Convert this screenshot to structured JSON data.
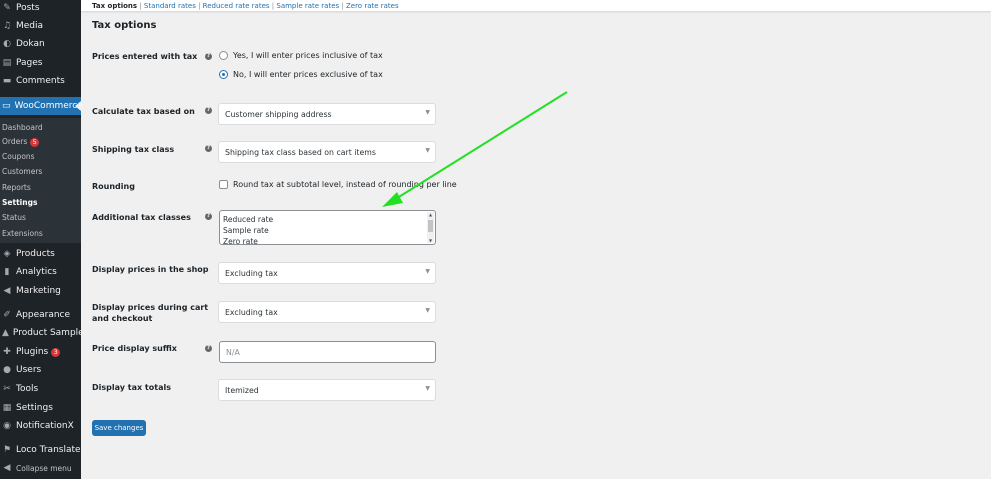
{
  "sidebar": {
    "items": [
      {
        "icon": "pushpin-icon",
        "label": "Posts"
      },
      {
        "icon": "media-icon",
        "label": "Media"
      },
      {
        "icon": "dokan-icon",
        "label": "Dokan"
      },
      {
        "icon": "pages-icon",
        "label": "Pages"
      },
      {
        "icon": "comments-icon",
        "label": "Comments"
      },
      {
        "icon": "woocommerce-icon",
        "label": "WooCommerce"
      },
      {
        "icon": "products-icon",
        "label": "Products"
      },
      {
        "icon": "analytics-icon",
        "label": "Analytics"
      },
      {
        "icon": "marketing-icon",
        "label": "Marketing"
      },
      {
        "icon": "appearance-icon",
        "label": "Appearance"
      },
      {
        "icon": "product-sample-icon",
        "label": "Product Sample"
      },
      {
        "icon": "plugins-icon",
        "label": "Plugins",
        "badge": "3"
      },
      {
        "icon": "users-icon",
        "label": "Users"
      },
      {
        "icon": "tools-icon",
        "label": "Tools"
      },
      {
        "icon": "settings-icon",
        "label": "Settings"
      },
      {
        "icon": "notificationx-icon",
        "label": "NotificationX"
      },
      {
        "icon": "loco-translate-icon",
        "label": "Loco Translate"
      },
      {
        "icon": "collapse-icon",
        "label": "Collapse menu"
      }
    ],
    "submenu": [
      {
        "label": "Dashboard"
      },
      {
        "label": "Orders",
        "badge": "5"
      },
      {
        "label": "Coupons"
      },
      {
        "label": "Customers"
      },
      {
        "label": "Reports"
      },
      {
        "label": "Settings"
      },
      {
        "label": "Status"
      },
      {
        "label": "Extensions"
      }
    ],
    "active_color": "#2271b1"
  },
  "subnav": {
    "current": "Tax options",
    "links": [
      "Standard rates",
      "Reduced rate rates",
      "Sample rate rates",
      "Zero rate rates"
    ],
    "separator": "|"
  },
  "form": {
    "title": "Tax options",
    "prices_entered": {
      "label": "Prices entered with tax",
      "options": [
        "Yes, I will enter prices inclusive of tax",
        "No, I will enter prices exclusive of tax"
      ],
      "selected_index": 1
    },
    "calc_based_on": {
      "label": "Calculate tax based on",
      "value": "Customer shipping address"
    },
    "shipping_tax_class": {
      "label": "Shipping tax class",
      "value": "Shipping tax class based on cart items"
    },
    "rounding": {
      "label": "Rounding",
      "checkbox_label": "Round tax at subtotal level, instead of rounding per line",
      "checked": false
    },
    "additional_classes": {
      "label": "Additional tax classes",
      "lines": [
        "Reduced rate",
        "Sample rate",
        "Zero rate"
      ]
    },
    "display_shop": {
      "label": "Display prices in the shop",
      "value": "Excluding tax"
    },
    "display_cart": {
      "label": "Display prices during cart and checkout",
      "value": "Excluding tax"
    },
    "price_suffix": {
      "label": "Price display suffix",
      "placeholder": "N/A"
    },
    "display_totals": {
      "label": "Display tax totals",
      "value": "Itemized"
    },
    "save_label": "Save changes"
  },
  "annotation": {
    "color": "#22e022"
  },
  "help_glyph": "?"
}
